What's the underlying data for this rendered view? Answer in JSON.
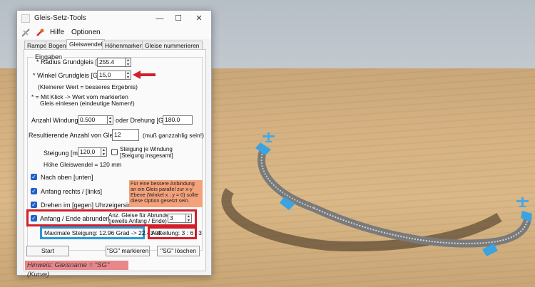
{
  "window": {
    "title": "Gleis-Setz-Tools",
    "minimize": "—",
    "maximize": "☐",
    "close": "✕"
  },
  "menu": {
    "hilfe": "Hilfe",
    "optionen": "Optionen"
  },
  "tabs": [
    "Rampe",
    "Bogen",
    "Gleiswendel",
    "Höhenmarken",
    "Gleise nummerieren"
  ],
  "active_tab": "Gleiswendel",
  "eingaben": {
    "title": "Eingaben",
    "radius_label": "* Radius Grundgleis [mm]:",
    "radius_value": "255.4",
    "winkel_label": "* Winkel Grundgleis [Grad]:",
    "winkel_value": "15,0",
    "hint_smaller": "(Kleinerer  Wert = besseres Ergebnis)",
    "note_line1": "* = Mit Klick -> Wert vom markierten",
    "note_line2": "Gleis einlesen (eindeutige Namen!)",
    "windungen_label": "Anzahl Windungen:",
    "windungen_value": "0.500",
    "oder_label": "oder  Drehung [Grad]:",
    "drehung_value": "180.0",
    "resultierende_label": "Resultierende Anzahl von Gleisen:",
    "resultierende_value": "12",
    "ganzzahlig": "(muß ganzzahlig sein!)",
    "steigung_label": "Steigung [mm]:",
    "steigung_value": "120,0",
    "steigung_windung_label1": "Steigung je Windung",
    "steigung_windung_label2": "[Steigung insgesamt]",
    "hoehe_label": "Höhe Gleiswendel = 120 mm"
  },
  "options": {
    "nach_oben": "Nach oben [unten]",
    "anfang_rechts": "Anfang rechts / [links]",
    "drehen": "Drehen im [gegen] Uhrzeigersinn",
    "abrunden": "Anfang / Ende  abrunden",
    "anz_label1": "Anz. Gleise für Abrunden",
    "anz_label2": "(jeweils Anfang / Ende)",
    "anz_value": "3"
  },
  "note_box": "Für eine bessere Anbindung an ein Gleis parallel zur x-y Ebene (Winkel x ; y = 0) sollte diese Option gesetzt sein.",
  "max_steigung": "Maximale Steigung: 12.96 Grad -> 22.43 %",
  "aufteilung": "Aufteilung: 3 : 6 : 3",
  "buttons": {
    "start": "Start",
    "markieren": "\"SG\" markieren",
    "loeschen": "\"SG\" löschen"
  },
  "hinweis": "Hinweis: Gleisname = \"SG\" (Kurve)",
  "icons": [
    "rail-tool-icon",
    "wrench-icon",
    "app-icon"
  ],
  "colors": {
    "highlight_red": "#d21f2a",
    "highlight_blue": "#2a9ad6",
    "note_orange": "#f4a27c",
    "hint_pink": "#e8878a"
  }
}
